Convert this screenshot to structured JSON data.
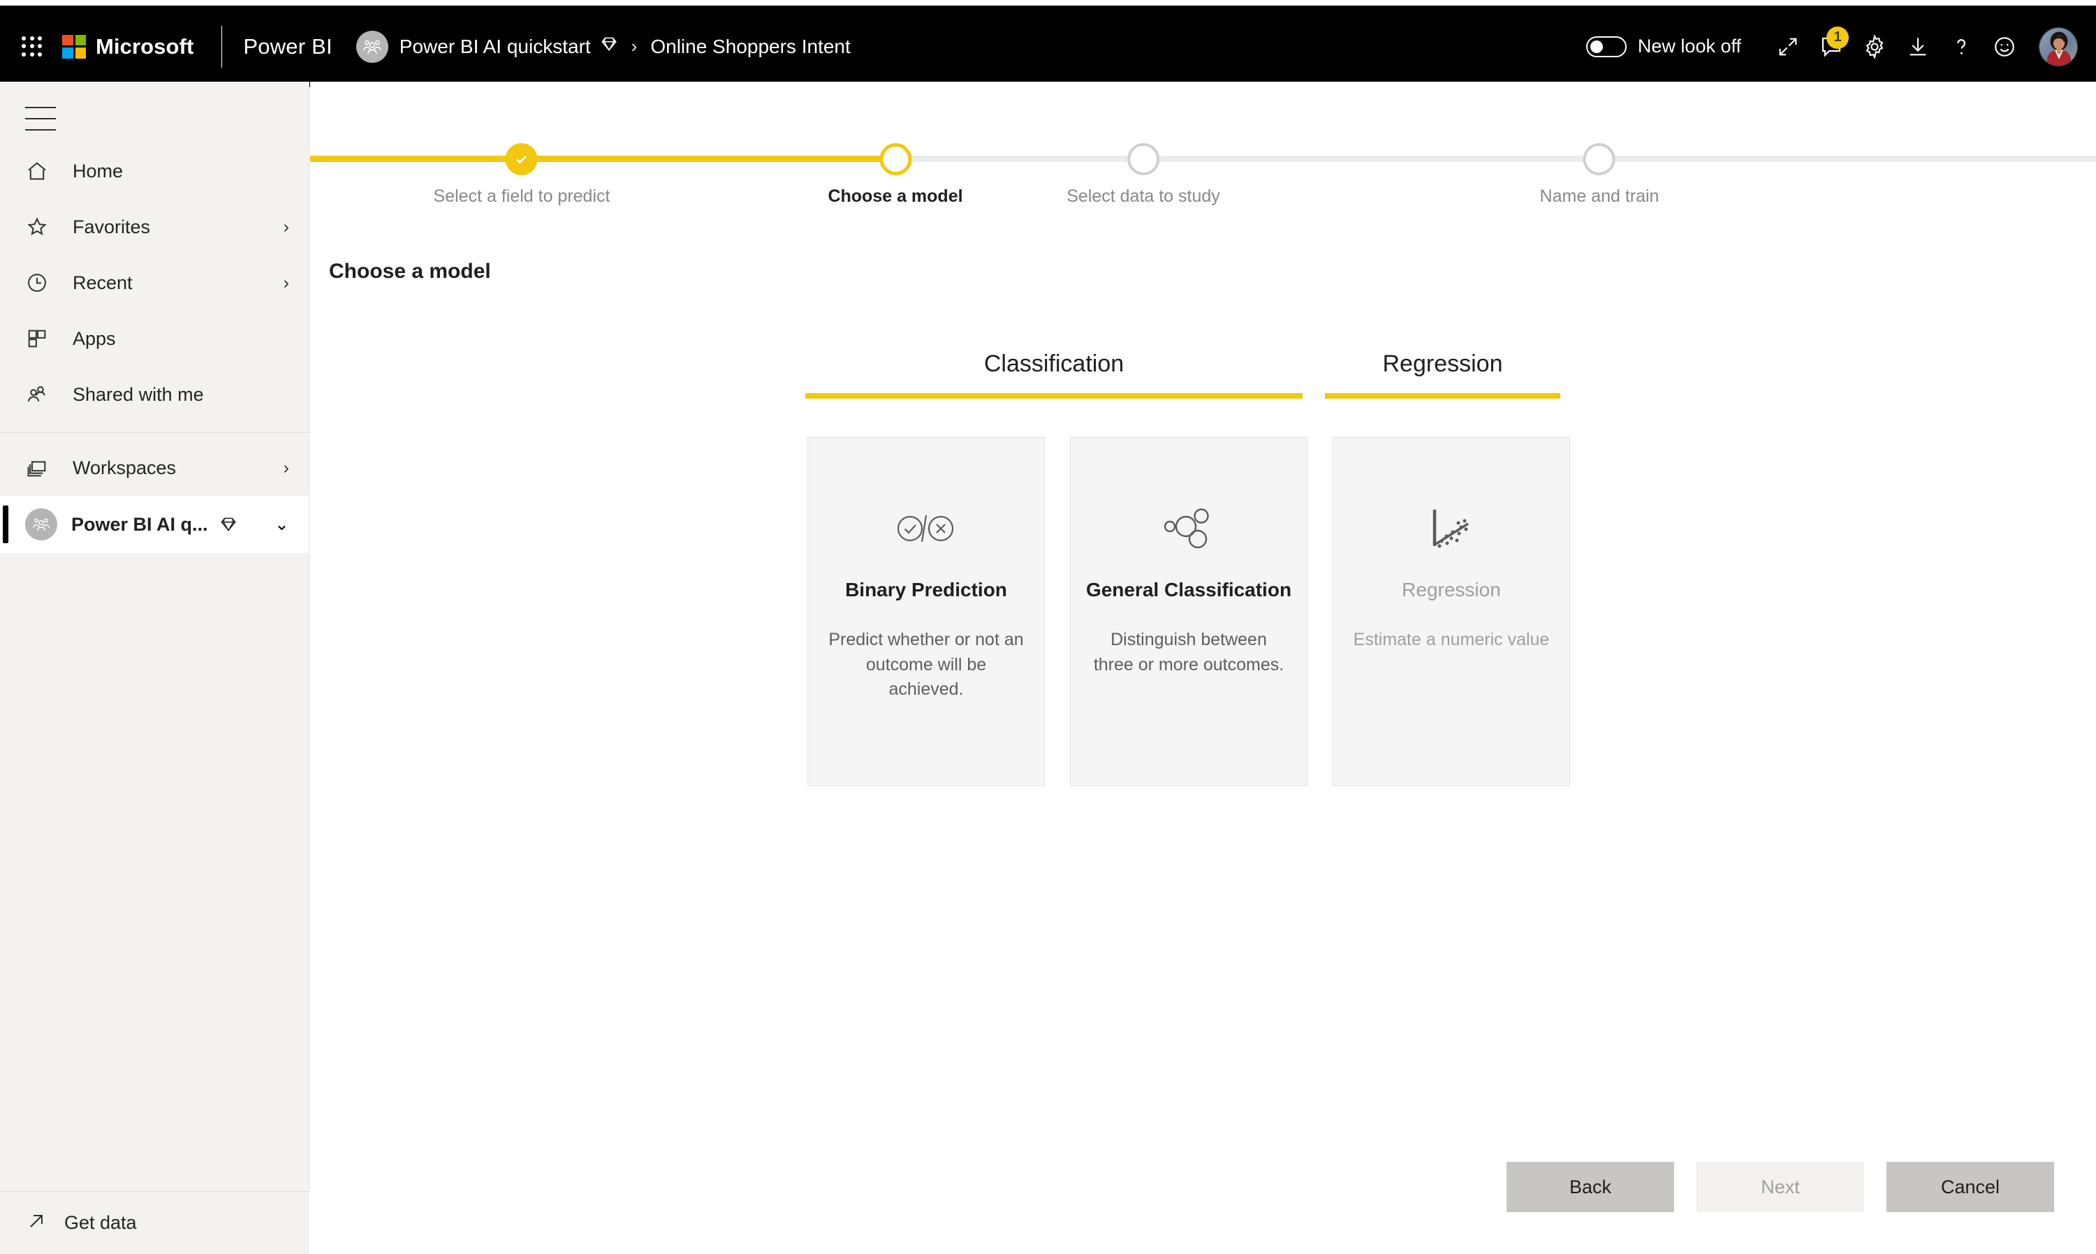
{
  "header": {
    "waffle_label": "app-launcher",
    "microsoft_label": "Microsoft",
    "product_label": "Power BI",
    "workspace_name": "Power BI AI quickstart",
    "breadcrumb_separator": "›",
    "item_name": "Online Shoppers Intent",
    "toggle_label": "New look off",
    "toggle_state": "off",
    "notification_count": "1",
    "icons": {
      "fullscreen": "fullscreen-icon",
      "notifications": "notifications-icon",
      "settings": "gear-icon",
      "download": "download-icon",
      "help": "help-icon",
      "feedback": "feedback-smiley-icon",
      "avatar": "user-avatar"
    }
  },
  "sidebar": {
    "collapse_label": "hamburger-menu",
    "items": [
      {
        "label": "Home",
        "icon": "home-icon",
        "chevron": ""
      },
      {
        "label": "Favorites",
        "icon": "star-icon",
        "chevron": "›"
      },
      {
        "label": "Recent",
        "icon": "clock-icon",
        "chevron": "›"
      },
      {
        "label": "Apps",
        "icon": "apps-grid-icon",
        "chevron": ""
      },
      {
        "label": "Shared with me",
        "icon": "shared-people-icon",
        "chevron": ""
      },
      {
        "label": "Workspaces",
        "icon": "workspaces-icon",
        "chevron": "›"
      }
    ],
    "active_workspace": {
      "label": "Power BI AI q...",
      "premium_icon": "diamond-premium-icon",
      "chevron": "⌄"
    },
    "get_data": {
      "label": "Get data",
      "icon": "arrow-up-right-icon"
    }
  },
  "wizard": {
    "steps": [
      {
        "label": "Select a field to predict",
        "state": "done"
      },
      {
        "label": "Choose a model",
        "state": "current"
      },
      {
        "label": "Select data to study",
        "state": "todo"
      },
      {
        "label": "Name and train",
        "state": "todo"
      }
    ],
    "title": "Choose a model",
    "tabs": [
      {
        "label": "Classification"
      },
      {
        "label": "Regression"
      }
    ],
    "models": [
      {
        "title": "Binary Prediction",
        "description": "Predict whether or not an outcome will be achieved.",
        "icon": "binary-check-cross-icon",
        "state": "enabled"
      },
      {
        "title": "General Classification",
        "description": "Distinguish between three or more outcomes.",
        "icon": "clustered-circles-icon",
        "state": "enabled"
      },
      {
        "title": "Regression",
        "description": "Estimate a numeric value",
        "icon": "scatter-trendline-icon",
        "state": "disabled"
      }
    ],
    "buttons": {
      "back": {
        "label": "Back",
        "state": "enabled"
      },
      "next": {
        "label": "Next",
        "state": "disabled"
      },
      "cancel": {
        "label": "Cancel",
        "state": "enabled"
      }
    }
  },
  "colors": {
    "accent_yellow": "#f2c811",
    "header_black": "#000000",
    "sidebar_bg": "#f3f2f1",
    "card_bg": "#f5f5f5",
    "disabled_text": "#a19f9d"
  }
}
